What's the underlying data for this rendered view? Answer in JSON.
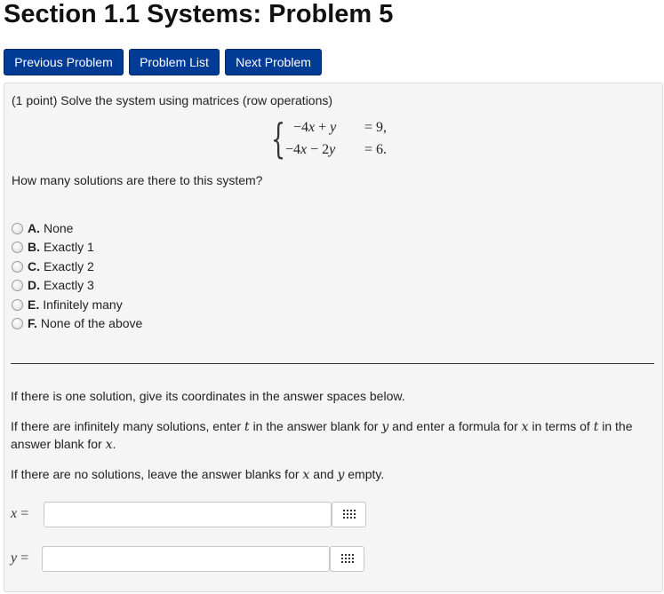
{
  "page": {
    "title": "Section 1.1 Systems: Problem 5"
  },
  "nav": {
    "previous": "Previous Problem",
    "list": "Problem List",
    "next": "Next Problem"
  },
  "problem": {
    "points": "(1 point)",
    "prompt": "Solve the system using matrices (row operations)",
    "equations": [
      {
        "lhs_coef_x": "−4",
        "lhs_var_x": "x",
        "op": "+",
        "lhs_coef_y": "",
        "lhs_var_y": "y",
        "rhs": "= 9,"
      },
      {
        "lhs_coef_x": "−4",
        "lhs_var_x": "x",
        "op": "−",
        "lhs_coef_y": "2",
        "lhs_var_y": "y",
        "rhs": "= 6."
      }
    ],
    "question": "How many solutions are there to this system?",
    "options": [
      {
        "letter": "A.",
        "text": "None"
      },
      {
        "letter": "B.",
        "text": "Exactly 1"
      },
      {
        "letter": "C.",
        "text": "Exactly 2"
      },
      {
        "letter": "D.",
        "text": "Exactly 3"
      },
      {
        "letter": "E.",
        "text": "Infinitely many"
      },
      {
        "letter": "F.",
        "text": "None of the above"
      }
    ],
    "instr1": "If there is one solution, give its coordinates in the answer spaces below.",
    "instr2_a": "If there are infinitely many solutions, enter",
    "instr2_t": "t",
    "instr2_b": "in the answer blank for",
    "instr2_y": "y",
    "instr2_c": "and enter a formula for",
    "instr2_x": "x",
    "instr2_d": "in terms of",
    "instr2_t2": "t",
    "instr2_e": "in the",
    "instr2_line2_a": "answer blank for",
    "instr2_line2_x": "x",
    "instr2_line2_b": ".",
    "instr3_a": "If there are no solutions, leave the answer blanks for",
    "instr3_x": "x",
    "instr3_and": "and",
    "instr3_y": "y",
    "instr3_b": "empty.",
    "answers": [
      {
        "var": "x",
        "eq": "=",
        "value": ""
      },
      {
        "var": "y",
        "eq": "=",
        "value": ""
      }
    ]
  },
  "colors": {
    "nav_button": "#003b95",
    "panel_bg": "#f5f5f5"
  },
  "icons": {
    "matrix_button": "matrix-grid-icon"
  }
}
